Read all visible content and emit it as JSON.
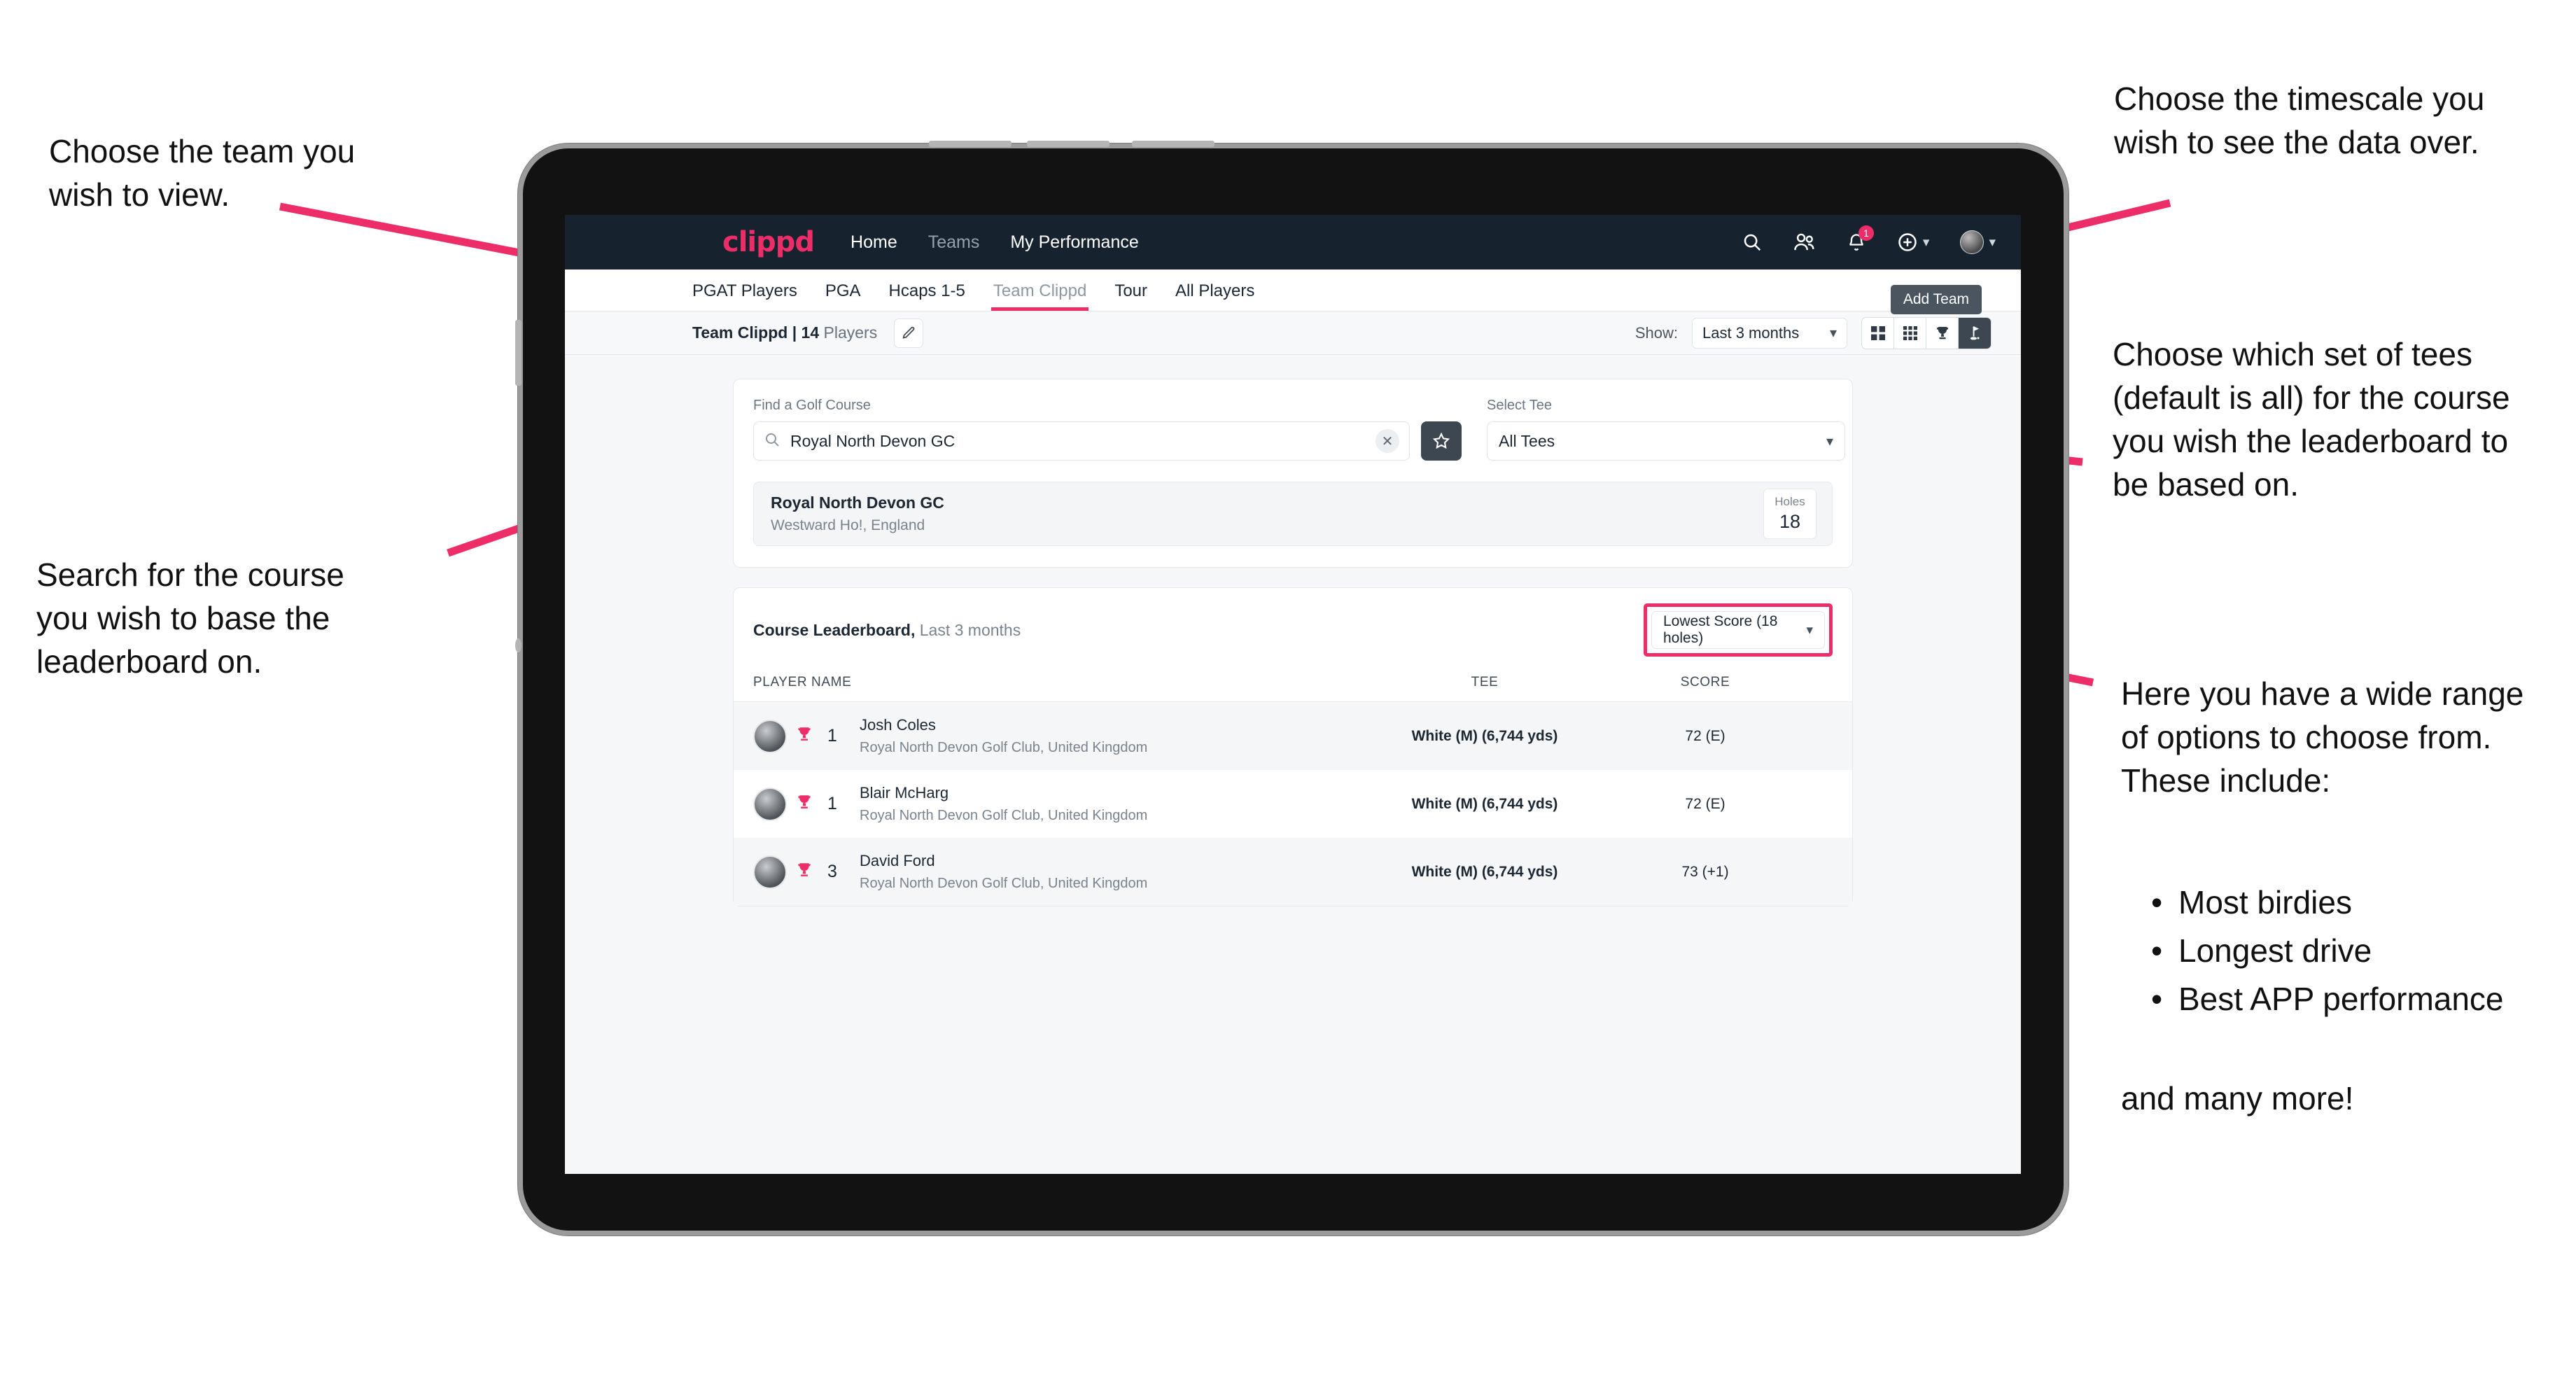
{
  "annotations": {
    "team": "Choose the team you\nwish to view.",
    "timescale": "Choose the timescale you\nwish to see the data over.",
    "tees": "Choose which set of tees\n(default is all) for the course\nyou wish the leaderboard to\nbe based on.",
    "search": "Search for the course\nyou wish to base the\nleaderboard on.",
    "options_intro": "Here you have a wide range\nof options to choose from.\nThese include:",
    "options_list": [
      "Most birdies",
      "Longest drive",
      "Best APP performance"
    ],
    "options_outro": "and many more!"
  },
  "navbar": {
    "brand": "clippd",
    "links": [
      {
        "label": "Home",
        "active": true
      },
      {
        "label": "Teams",
        "active": false
      },
      {
        "label": "My Performance",
        "active": true
      }
    ],
    "icons": {
      "search": "search-icon",
      "people": "people-icon",
      "bell": "bell-icon",
      "plus": "plus-circle-icon",
      "avatar": "avatar-icon"
    },
    "notification_count": "1"
  },
  "tabs": [
    {
      "label": "PGAT Players",
      "active": false
    },
    {
      "label": "PGA",
      "active": false
    },
    {
      "label": "Hcaps 1-5",
      "active": false
    },
    {
      "label": "Team Clippd",
      "active": true
    },
    {
      "label": "Tour",
      "active": false
    },
    {
      "label": "All Players",
      "active": false
    }
  ],
  "tooltip": {
    "label": "Add Team"
  },
  "subheader": {
    "team_name": "Team Clippd",
    "separator": " | ",
    "player_count": "14",
    "players_word": " Players",
    "edit_icon": "pencil-icon",
    "show_label": "Show:",
    "period_value": "Last 3 months",
    "view_buttons": [
      {
        "name": "grid-2x2-view",
        "active": false
      },
      {
        "name": "grid-3x3-view",
        "active": false
      },
      {
        "name": "trophy-view",
        "active": false
      },
      {
        "name": "course-view",
        "active": true
      }
    ]
  },
  "search_panel": {
    "course_label": "Find a Golf Course",
    "course_value": "Royal North Devon GC",
    "course_placeholder": "Find a Golf Course",
    "clear_icon": "close-icon",
    "star_icon": "star-icon",
    "tee_label": "Select Tee",
    "tee_value": "All Tees"
  },
  "course_result": {
    "name": "Royal North Devon GC",
    "location": "Westward Ho!, England",
    "holes_label": "Holes",
    "holes_value": "18"
  },
  "leaderboard": {
    "title": "Course Leaderboard,",
    "subtitle": " Last 3 months",
    "metric_value": "Lowest Score (18 holes)",
    "columns": [
      "PLAYER NAME",
      "TEE",
      "SCORE"
    ],
    "rows": [
      {
        "rank": "1",
        "name": "Josh Coles",
        "club": "Royal North Devon Golf Club, United Kingdom",
        "tee": "White (M) (6,744 yds)",
        "score": "72 (E)"
      },
      {
        "rank": "1",
        "name": "Blair McHarg",
        "club": "Royal North Devon Golf Club, United Kingdom",
        "tee": "White (M) (6,744 yds)",
        "score": "72 (E)"
      },
      {
        "rank": "3",
        "name": "David Ford",
        "club": "Royal North Devon Golf Club, United Kingdom",
        "tee": "White (M) (6,744 yds)",
        "score": "73 (+1)"
      }
    ]
  },
  "colors": {
    "accent": "#ec2d68",
    "navbar": "#16232e",
    "dark_button": "#3d4752",
    "screen_bg": "#f6f7f9"
  }
}
